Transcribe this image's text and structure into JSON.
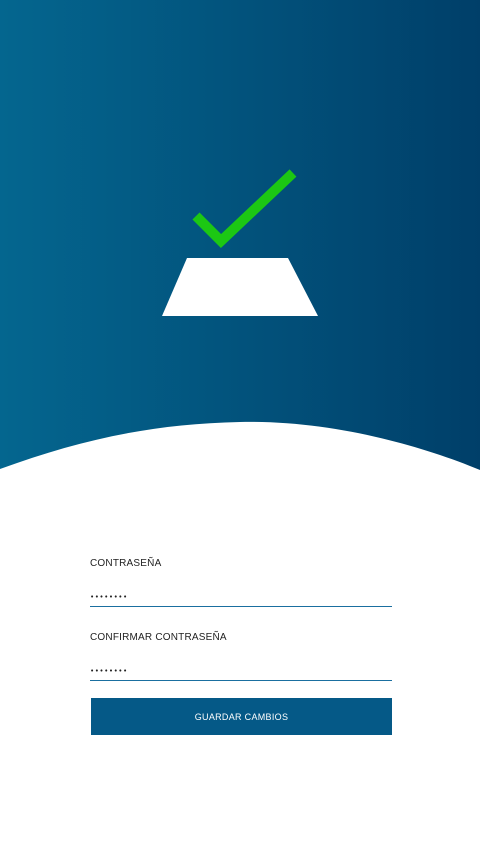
{
  "colors": {
    "gradient_start": "#04668f",
    "gradient_end": "#003f69",
    "check": "#1cc714",
    "accent": "#1a6fa0",
    "button": "#055987"
  },
  "hero": {
    "icon": "ballot-box-check-icon"
  },
  "form": {
    "password": {
      "label": "CONTRASEÑA",
      "value": "••••••••"
    },
    "confirm_password": {
      "label": "CONFIRMAR CONTRASEÑA",
      "value": "••••••••"
    },
    "save_label": "GUARDAR CAMBIOS"
  }
}
